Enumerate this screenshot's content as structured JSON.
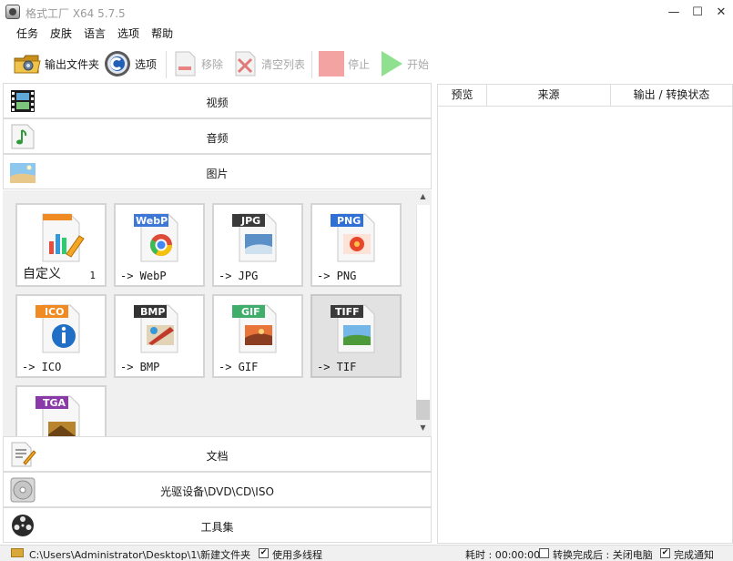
{
  "window": {
    "title": "格式工厂 X64 5.7.5",
    "controls": {
      "minimize": "—",
      "maximize": "☐",
      "close": "✕"
    }
  },
  "menu": [
    "任务",
    "皮肤",
    "语言",
    "选项",
    "帮助"
  ],
  "toolbar": {
    "output_folder": "输出文件夹",
    "options": "选项",
    "remove": "移除",
    "clear_list": "清空列表",
    "stop": "停止",
    "start": "开始"
  },
  "categories": {
    "video": "视频",
    "audio": "音频",
    "image": "图片",
    "document": "文档",
    "optical": "光驱设备\\DVD\\CD\\ISO",
    "tools": "工具集"
  },
  "image_formats": {
    "custom_label": "自定义",
    "custom_count": "1",
    "items": [
      {
        "badge": "WebP",
        "label": "-> WebP",
        "badge_color": "#3d78d8"
      },
      {
        "badge": "JPG",
        "label": "-> JPG",
        "badge_color": "#3a3a3a"
      },
      {
        "badge": "PNG",
        "label": "-> PNG",
        "badge_color": "#2f6fd6"
      },
      {
        "badge": "ICO",
        "label": "-> ICO",
        "badge_color": "#f08a22"
      },
      {
        "badge": "BMP",
        "label": "-> BMP",
        "badge_color": "#333333"
      },
      {
        "badge": "GIF",
        "label": "-> GIF",
        "badge_color": "#3fae6a"
      },
      {
        "badge": "TIFF",
        "label": "-> TIF",
        "badge_color": "#3a3a3a"
      },
      {
        "badge": "TGA",
        "label": "",
        "badge_color": "#8a3aa8"
      }
    ]
  },
  "task_table": {
    "columns": [
      "预览",
      "来源",
      "输出 / 转换状态"
    ]
  },
  "status": {
    "output_path": "C:\\Users\\Administrator\\Desktop\\1\\新建文件夹",
    "multithread": "使用多线程",
    "elapsed": "耗时 : 00:00:00",
    "after_done": "转换完成后 : 关闭电脑",
    "notify": "完成通知"
  }
}
